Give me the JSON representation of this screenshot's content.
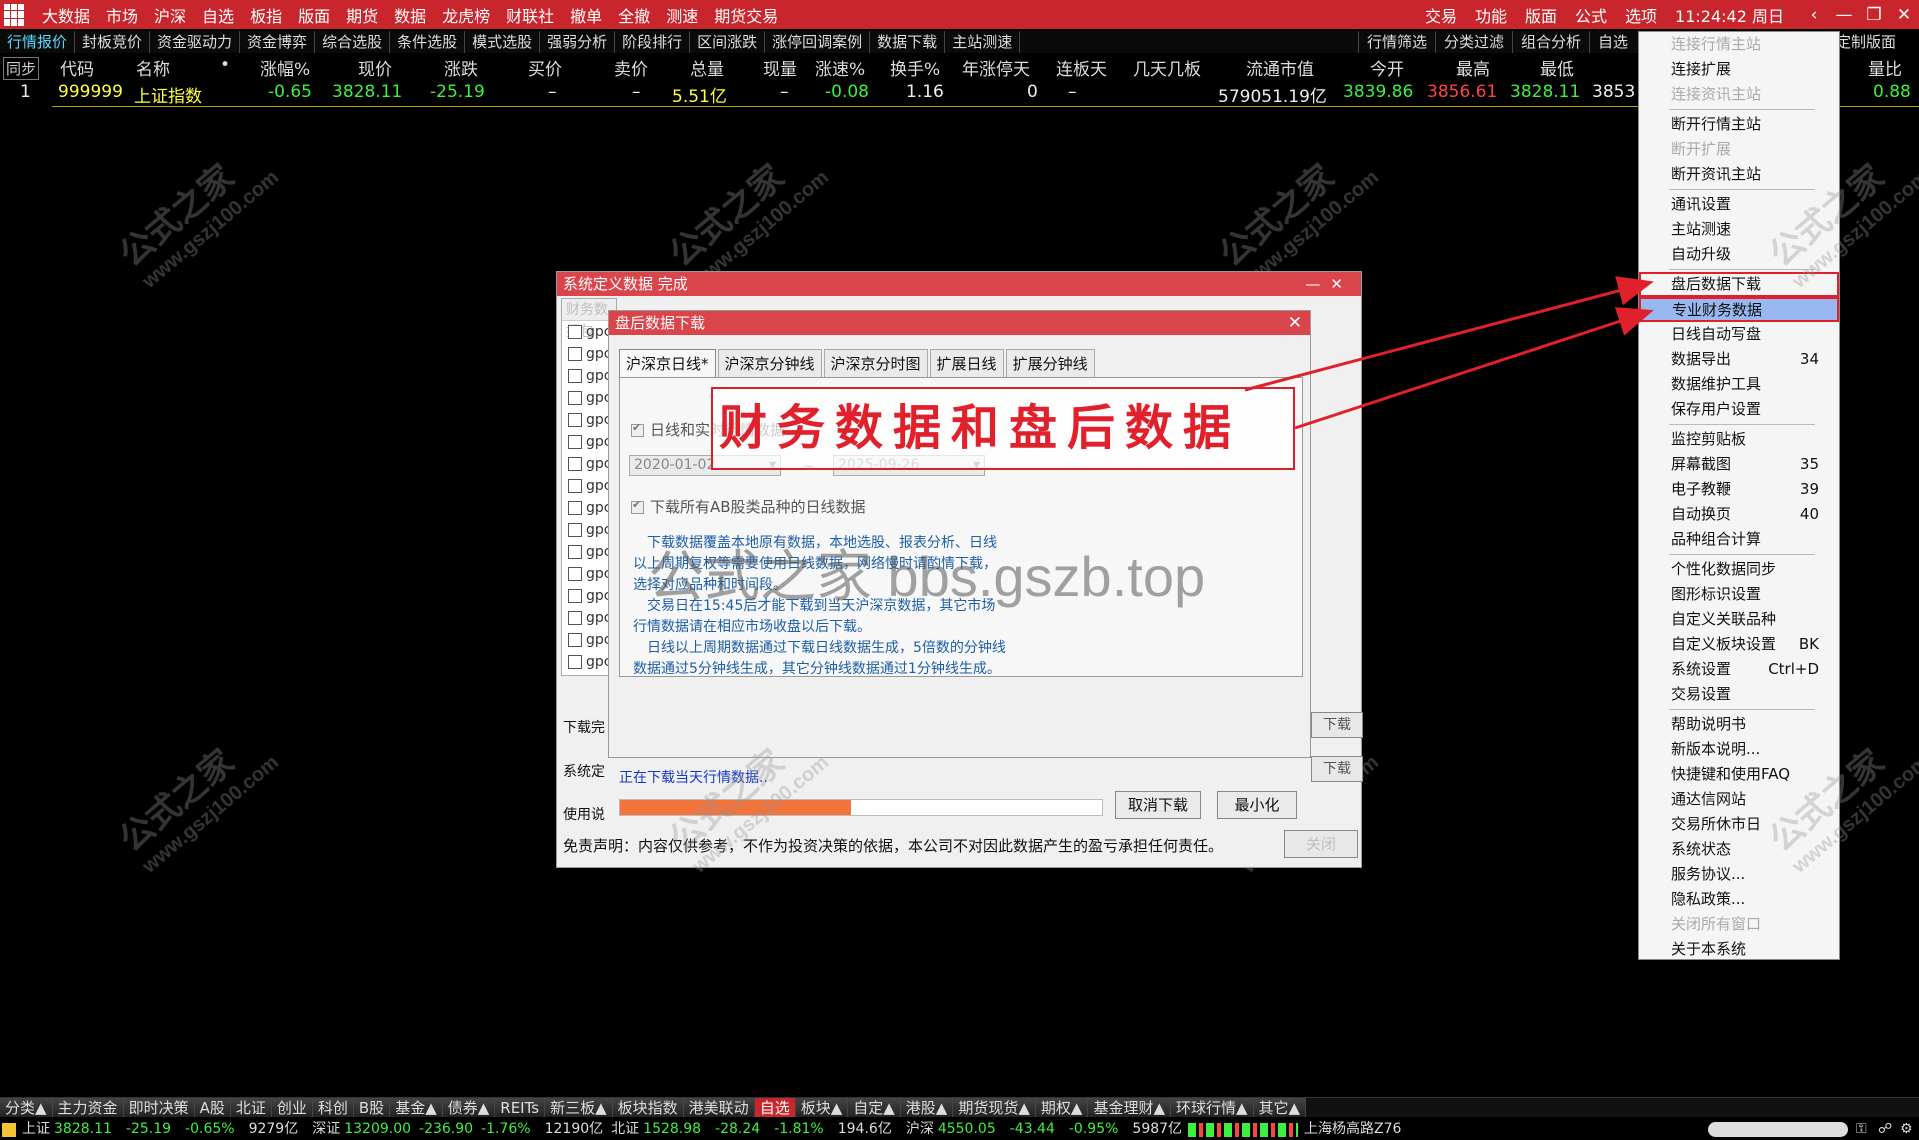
{
  "topbar": {
    "menus": [
      "大数据",
      "市场",
      "沪深",
      "自选",
      "板指",
      "版面",
      "期货",
      "数据",
      "龙虎榜",
      "财联社",
      "撤单",
      "全撤",
      "测速",
      "期货交易"
    ],
    "right": [
      "交易",
      "功能",
      "版面",
      "公式",
      "选项"
    ],
    "time": "11:24:42 周日",
    "icons": {
      "back": "‹",
      "min": "—",
      "restore": "❐",
      "close": "✕"
    }
  },
  "tabs": [
    "行情报价",
    "封板竞价",
    "资金驱动力",
    "资金博弈",
    "综合选股",
    "条件选股",
    "模式选股",
    "强弱分析",
    "阶段排行",
    "区间涨跌",
    "涨停回调案例",
    "数据下载",
    "主站测速"
  ],
  "tabs_right": [
    "行情筛选",
    "分类过滤",
    "组合分析",
    "自选"
  ],
  "custom_layout": "定制版面",
  "columns": [
    "同步",
    "代码",
    "名称",
    "•",
    "涨幅%",
    "现价",
    "涨跌",
    "买价",
    "卖价",
    "总量",
    "现量",
    "涨速%",
    "换手%",
    "年涨停天",
    "连板天",
    "几天几板",
    "流通市值",
    "今开",
    "最高",
    "最低",
    "量比"
  ],
  "row": {
    "idx": "1",
    "code": "999999",
    "name": "上证指数",
    "change_pct": "-0.65",
    "price": "3828.11",
    "change": "-25.19",
    "bid": "–",
    "ask": "–",
    "volume": "5.51亿",
    "cur_vol": "–",
    "speed": "-0.08",
    "turnover": "1.16",
    "year_limit": "0",
    "limit_days": "–",
    "market_cap": "579051.19亿",
    "open": "3839.86",
    "high": "3856.61",
    "low": "3828.11",
    "low_trunc": "3853",
    "vol_ratio": "0.88"
  },
  "watermark": {
    "cn": "公式之家",
    "url": "www.gszj100.com",
    "center": "公式之家 bbs.gszb.top"
  },
  "menu": [
    {
      "label": "连接行情主站",
      "disabled": true
    },
    {
      "label": "连接扩展"
    },
    {
      "label": "连接资讯主站",
      "disabled": true
    },
    {
      "sep": true
    },
    {
      "label": "断开行情主站"
    },
    {
      "label": "断开扩展",
      "disabled": true
    },
    {
      "label": "断开资讯主站"
    },
    {
      "sep": true
    },
    {
      "label": "通讯设置"
    },
    {
      "label": "主站测速"
    },
    {
      "label": "自动升级"
    },
    {
      "sep": true
    },
    {
      "label": "盘后数据下载",
      "boxed": true
    },
    {
      "label": "专业财务数据",
      "selected": true,
      "boxed": true
    },
    {
      "label": "日线自动写盘"
    },
    {
      "label": "数据导出",
      "shortcut": "34"
    },
    {
      "label": "数据维护工具"
    },
    {
      "label": "保存用户设置"
    },
    {
      "sep": true
    },
    {
      "label": "监控剪贴板"
    },
    {
      "label": "屏幕截图",
      "shortcut": "35"
    },
    {
      "label": "电子教鞭",
      "shortcut": "39"
    },
    {
      "label": "自动换页",
      "shortcut": "40"
    },
    {
      "label": "品种组合计算"
    },
    {
      "sep": true
    },
    {
      "label": "个性化数据同步"
    },
    {
      "label": "图形标识设置"
    },
    {
      "label": "自定义关联品种"
    },
    {
      "label": "自定义板块设置",
      "shortcut": "BK"
    },
    {
      "label": "系统设置",
      "shortcut": "Ctrl+D"
    },
    {
      "label": "交易设置"
    },
    {
      "sep": true
    },
    {
      "label": "帮助说明书"
    },
    {
      "label": "新版本说明..."
    },
    {
      "label": "快捷键和使用FAQ"
    },
    {
      "label": "通达信网站"
    },
    {
      "label": "交易所休市日"
    },
    {
      "label": "系统状态"
    },
    {
      "label": "服务协议..."
    },
    {
      "label": "隐私政策..."
    },
    {
      "label": "关闭所有窗口",
      "disabled": true
    },
    {
      "label": "关于本系统"
    }
  ],
  "back_dialog": {
    "title": "系统定义数据 完成",
    "list_header": "财务数据包",
    "items_prefix": "gpc",
    "label_download": "下载完",
    "label_system": "系统定",
    "label_usage": "使用说",
    "side_btn": "下载",
    "disclaimer": "免责声明：内容仅供参考，不作为投资决策的依据，本公司不对因此数据产生的盈亏承担任何责任。",
    "close": "关闭"
  },
  "dialog": {
    "title": "盘后数据下载",
    "tabs": [
      "沪深京日线*",
      "沪深京分钟线",
      "沪深京分时图",
      "扩展日线",
      "扩展分钟线"
    ],
    "check1": "日线和实时行情数据",
    "date_from": "2020-01-02",
    "date_to": "2025-09-26",
    "tilde": "~",
    "check2": "下载所有AB股类品种的日线数据",
    "desc": "　下载数据覆盖本地原有数据，本地选股、报表分析、日线以上周期复权等需要使用日线数据，网络慢时请酌情下载，选择对应品种和时间段。\n　交易日在15:45后才能下载到当天沪深京数据，其它市场行情数据请在相应市场收盘以后下载。\n　日线以上周期数据通过下载日线数据生成，5倍数的分钟线数据通过5分钟线生成，其它分钟线数据通过1分钟线生成。",
    "status": "正在下载当天行情数据..",
    "progress": 0.48,
    "btn_cancel": "取消下载",
    "btn_min": "最小化"
  },
  "annotation": "财务数据和盘后数据",
  "bottom_tabs": [
    "分类▲",
    "主力资金",
    "即时决策",
    "A股",
    "北证",
    "创业",
    "科创",
    "B股",
    "基金▲",
    "债券▲",
    "REITs",
    "新三板▲",
    "板块指数",
    "港美联动",
    "自选",
    "板块▲",
    "自定▲",
    "港股▲",
    "期货现货▲",
    "期权▲",
    "基金理财▲",
    "环球行情▲",
    "其它▲"
  ],
  "status": {
    "sh_name": "上证",
    "sh_val": "3828.11",
    "sh_chg": "-25.19",
    "sh_pct": "-0.65%",
    "sh_amt": "9279亿",
    "sz_name": "深证",
    "sz_val": "13209.00",
    "sz_chg": "-236.90",
    "sz_pct": "-1.76%",
    "sz_amt": "12190亿",
    "bz_name": "北证",
    "bz_val": "1528.98",
    "bz_chg": "-28.24",
    "bz_pct": "-1.81%",
    "bz_amt": "194.6亿",
    "hs_name": "沪深",
    "hs_val": "4550.05",
    "hs_chg": "-43.44",
    "hs_pct": "-0.95%",
    "hs_amt": "5987亿",
    "server": "上海杨高路Z76"
  }
}
